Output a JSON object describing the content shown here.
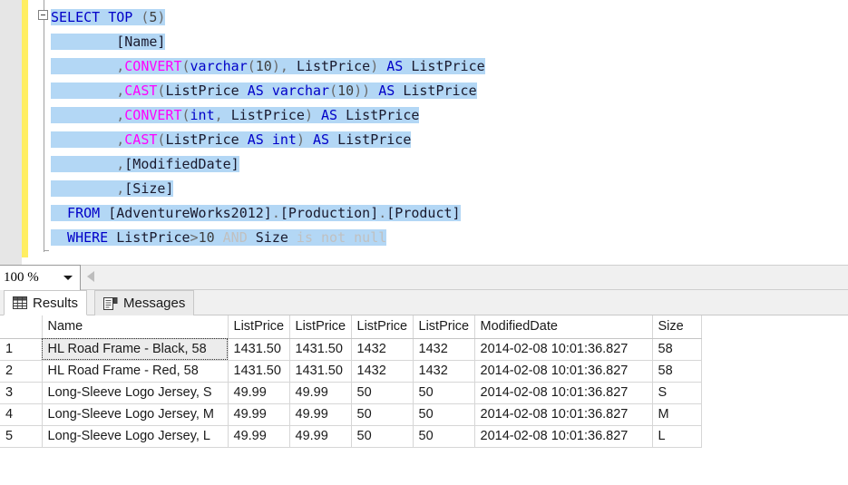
{
  "editor": {
    "lines": [
      [
        {
          "t": "SELECT TOP ",
          "c": "kw"
        },
        {
          "t": "(",
          "c": "punct"
        },
        {
          "t": "5",
          "c": "num"
        },
        {
          "t": ")",
          "c": "punct"
        }
      ],
      [
        {
          "t": "        [Name]",
          "c": "ident"
        }
      ],
      [
        {
          "t": "        ,",
          "c": "punct"
        },
        {
          "t": "CONVERT",
          "c": "fn"
        },
        {
          "t": "(",
          "c": "punct"
        },
        {
          "t": "varchar",
          "c": "kw"
        },
        {
          "t": "(",
          "c": "punct"
        },
        {
          "t": "10",
          "c": "num"
        },
        {
          "t": "), ",
          "c": "punct"
        },
        {
          "t": "ListPrice",
          "c": "ident"
        },
        {
          "t": ") ",
          "c": "punct"
        },
        {
          "t": "AS ",
          "c": "kw"
        },
        {
          "t": "ListPrice",
          "c": "ident"
        }
      ],
      [
        {
          "t": "        ,",
          "c": "punct"
        },
        {
          "t": "CAST",
          "c": "fn"
        },
        {
          "t": "(",
          "c": "punct"
        },
        {
          "t": "ListPrice ",
          "c": "ident"
        },
        {
          "t": "AS ",
          "c": "kw"
        },
        {
          "t": "varchar",
          "c": "kw"
        },
        {
          "t": "(",
          "c": "punct"
        },
        {
          "t": "10",
          "c": "num"
        },
        {
          "t": ")) ",
          "c": "punct"
        },
        {
          "t": "AS ",
          "c": "kw"
        },
        {
          "t": "ListPrice",
          "c": "ident"
        }
      ],
      [
        {
          "t": "        ,",
          "c": "punct"
        },
        {
          "t": "CONVERT",
          "c": "fn"
        },
        {
          "t": "(",
          "c": "punct"
        },
        {
          "t": "int",
          "c": "kw"
        },
        {
          "t": ", ",
          "c": "punct"
        },
        {
          "t": "ListPrice",
          "c": "ident"
        },
        {
          "t": ") ",
          "c": "punct"
        },
        {
          "t": "AS ",
          "c": "kw"
        },
        {
          "t": "ListPrice",
          "c": "ident"
        }
      ],
      [
        {
          "t": "        ,",
          "c": "punct"
        },
        {
          "t": "CAST",
          "c": "fn"
        },
        {
          "t": "(",
          "c": "punct"
        },
        {
          "t": "ListPrice ",
          "c": "ident"
        },
        {
          "t": "AS ",
          "c": "kw"
        },
        {
          "t": "int",
          "c": "kw"
        },
        {
          "t": ") ",
          "c": "punct"
        },
        {
          "t": "AS ",
          "c": "kw"
        },
        {
          "t": "ListPrice",
          "c": "ident"
        }
      ],
      [
        {
          "t": "        ,",
          "c": "punct"
        },
        {
          "t": "[ModifiedDate]",
          "c": "ident"
        }
      ],
      [
        {
          "t": "        ,",
          "c": "punct"
        },
        {
          "t": "[Size]",
          "c": "ident"
        }
      ],
      [
        {
          "t": "  FROM ",
          "c": "kw"
        },
        {
          "t": "[AdventureWorks2012]",
          "c": "ident"
        },
        {
          "t": ".",
          "c": "punct"
        },
        {
          "t": "[Production]",
          "c": "ident"
        },
        {
          "t": ".",
          "c": "punct"
        },
        {
          "t": "[Product]",
          "c": "ident"
        }
      ],
      [
        {
          "t": "  WHERE ",
          "c": "kw"
        },
        {
          "t": "ListPrice",
          "c": "ident"
        },
        {
          "t": ">",
          "c": "punct"
        },
        {
          "t": "10",
          "c": "num"
        },
        {
          "t": " AND ",
          "c": "dim"
        },
        {
          "t": "Size",
          "c": "ident"
        },
        {
          "t": " is not null",
          "c": "dim"
        }
      ]
    ],
    "sql_text": "SELECT TOP (5)\n        [Name]\n        ,CONVERT(varchar(10), ListPrice) AS ListPrice\n        ,CAST(ListPrice AS varchar(10)) AS ListPrice\n        ,CONVERT(int, ListPrice) AS ListPrice\n        ,CAST(ListPrice AS int) AS ListPrice\n        ,[ModifiedDate]\n        ,[Size]\n  FROM [AdventureWorks2012].[Production].[Product]\n  WHERE ListPrice>10 AND Size is not null"
  },
  "zoom_bar": {
    "zoom_value": "100 %",
    "dropdown_icon": "chevron-down-icon",
    "scroll_left_icon": "triangle-left-icon"
  },
  "tabs": [
    {
      "label": "Results",
      "icon": "grid-icon",
      "active": true
    },
    {
      "label": "Messages",
      "icon": "document-icon",
      "active": false
    }
  ],
  "grid": {
    "row_header_label": "",
    "columns": [
      "Name",
      "ListPrice",
      "ListPrice",
      "ListPrice",
      "ListPrice",
      "ModifiedDate",
      "Size"
    ],
    "rows": [
      {
        "num": "1",
        "cells": [
          "HL Road Frame - Black, 58",
          "1431.50",
          "1431.50",
          "1432",
          "1432",
          "2014-02-08 10:01:36.827",
          "58"
        ]
      },
      {
        "num": "2",
        "cells": [
          "HL Road Frame - Red, 58",
          "1431.50",
          "1431.50",
          "1432",
          "1432",
          "2014-02-08 10:01:36.827",
          "58"
        ]
      },
      {
        "num": "3",
        "cells": [
          "Long-Sleeve Logo Jersey, S",
          "49.99",
          "49.99",
          "50",
          "50",
          "2014-02-08 10:01:36.827",
          "S"
        ]
      },
      {
        "num": "4",
        "cells": [
          "Long-Sleeve Logo Jersey, M",
          "49.99",
          "49.99",
          "50",
          "50",
          "2014-02-08 10:01:36.827",
          "M"
        ]
      },
      {
        "num": "5",
        "cells": [
          "Long-Sleeve Logo Jersey, L",
          "49.99",
          "49.99",
          "50",
          "50",
          "2014-02-08 10:01:36.827",
          "L"
        ]
      }
    ],
    "selected_cell": {
      "row": 0,
      "col": 0
    }
  },
  "colors": {
    "keyword": "#0000c8",
    "function": "#ff00ff",
    "selection": "#b3d7f5",
    "change_bar": "#ffee62",
    "grid_border": "#d6d6d6"
  }
}
